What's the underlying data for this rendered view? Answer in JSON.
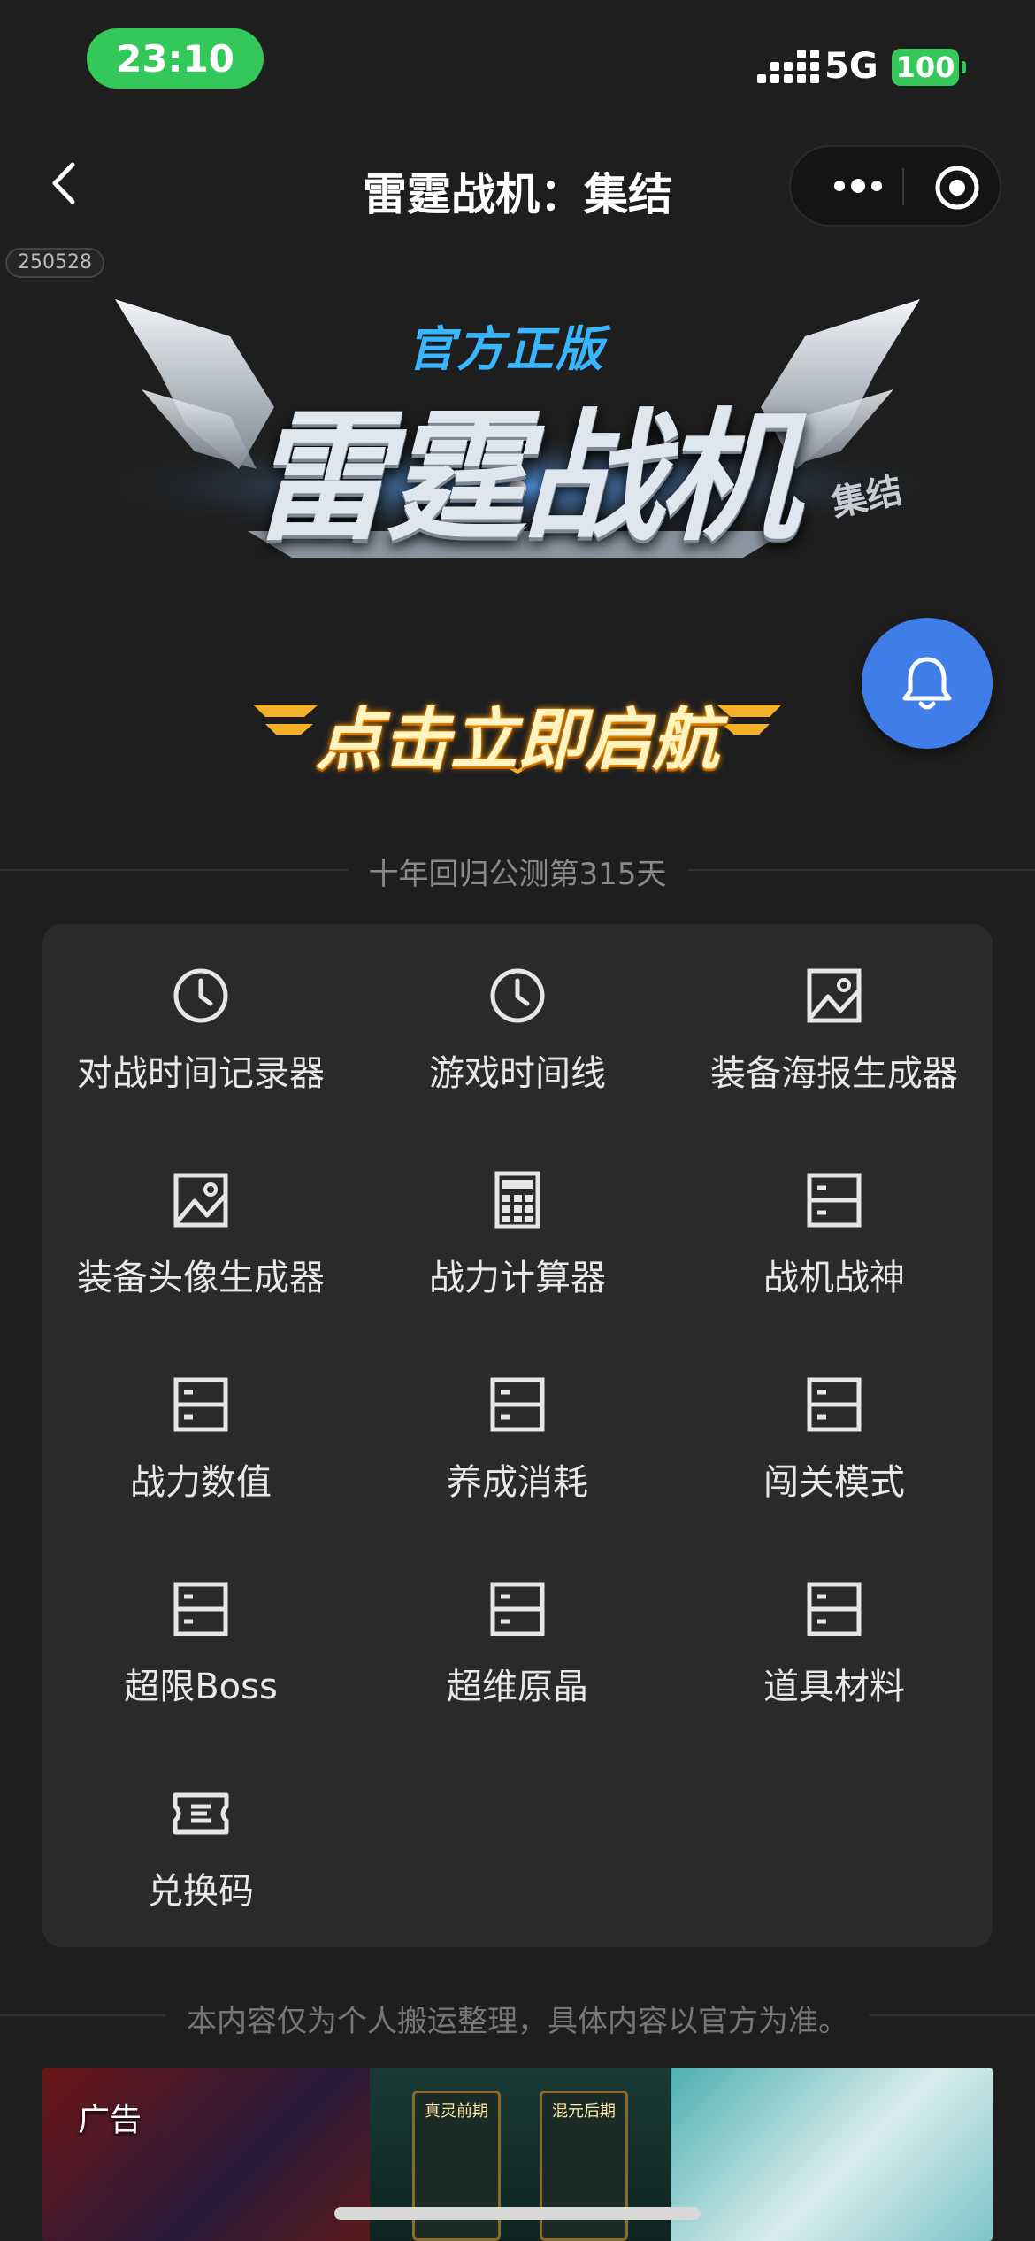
{
  "status_bar": {
    "time": "23:10",
    "network": "5G",
    "battery": "100"
  },
  "nav": {
    "title": "雷霆战机：集结",
    "back_icon": "chevron-left-icon",
    "more_icon": "more-dots-icon",
    "close_icon": "target-circle-icon"
  },
  "version_tag": "250528",
  "banner": {
    "official_label": "官方正版",
    "logo_text": "雷霆战机",
    "logo_sub": "集结",
    "launch_label": "点击立即启航"
  },
  "notification_icon": "bell-icon",
  "day_text": "十年回归公测第315天",
  "tools": [
    {
      "label": "对战时间记录器",
      "icon": "clock-icon"
    },
    {
      "label": "游戏时间线",
      "icon": "clock-icon"
    },
    {
      "label": "装备海报生成器",
      "icon": "image-icon"
    },
    {
      "label": "装备头像生成器",
      "icon": "image-icon"
    },
    {
      "label": "战力计算器",
      "icon": "calculator-icon"
    },
    {
      "label": "战机战神",
      "icon": "panel-icon"
    },
    {
      "label": "战力数值",
      "icon": "panel-icon"
    },
    {
      "label": "养成消耗",
      "icon": "panel-icon"
    },
    {
      "label": "闯关模式",
      "icon": "panel-icon"
    },
    {
      "label": "超限Boss",
      "icon": "panel-icon"
    },
    {
      "label": "超维原晶",
      "icon": "panel-icon"
    },
    {
      "label": "道具材料",
      "icon": "panel-icon"
    },
    {
      "label": "兑换码",
      "icon": "ticket-icon"
    }
  ],
  "disclaimer": "本内容仅为个人搬运整理，具体内容以官方为准。",
  "ad": {
    "label": "广告",
    "card_titles": [
      "真灵前期",
      "混元后期"
    ]
  },
  "colors": {
    "background": "#1e1e1e",
    "panel": "#2a2a2a",
    "accent_blue": "#3f7de8",
    "status_green": "#34c759"
  }
}
